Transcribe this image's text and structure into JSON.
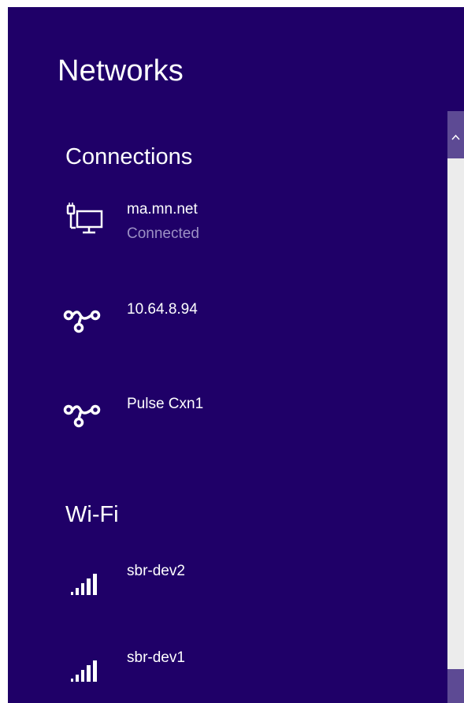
{
  "pane": {
    "title": "Networks",
    "background": "#1f0068"
  },
  "connections": {
    "heading": "Connections",
    "items": [
      {
        "name": "ma.mn.net",
        "status": "Connected",
        "icon": "ethernet-icon"
      },
      {
        "name": "10.64.8.94",
        "icon": "vpn-icon"
      },
      {
        "name": "Pulse Cxn1",
        "icon": "vpn-icon"
      }
    ]
  },
  "wifi": {
    "heading": "Wi-Fi",
    "items": [
      {
        "name": "sbr-dev2",
        "icon": "wifi-signal-icon"
      },
      {
        "name": "sbr-dev1",
        "icon": "wifi-signal-icon"
      }
    ]
  },
  "scrollbar": {
    "up_arrow": "^"
  }
}
